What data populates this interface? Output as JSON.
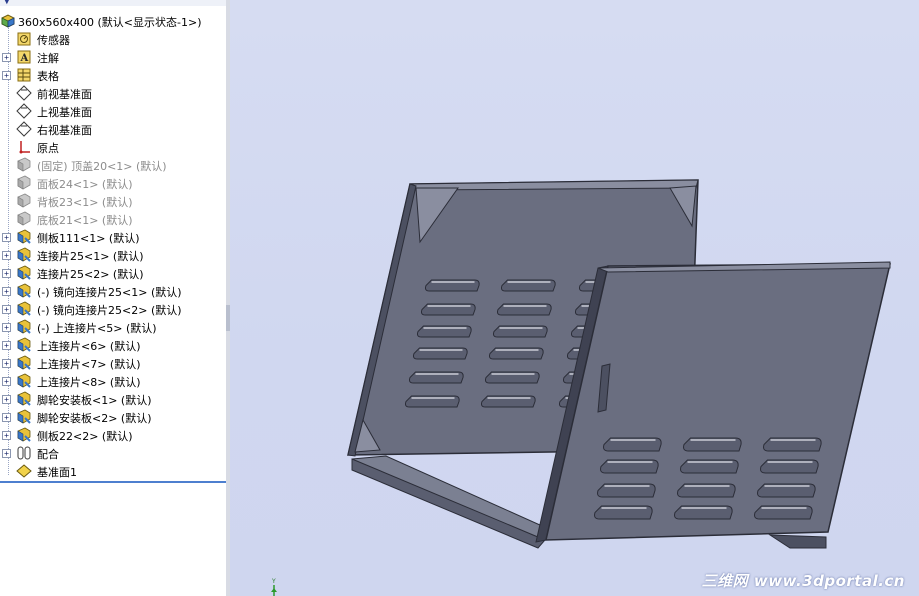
{
  "tree": {
    "root": {
      "label": "360x560x400   (默认<显示状态-1>)"
    },
    "items": [
      {
        "label": "传感器",
        "icon": "sensor-icon",
        "expander": "",
        "dim": false
      },
      {
        "label": "注解",
        "icon": "annotation-icon",
        "expander": "+",
        "dim": false
      },
      {
        "label": "表格",
        "icon": "table-icon",
        "expander": "+",
        "dim": false
      },
      {
        "label": "前视基准面",
        "icon": "plane-icon",
        "expander": "",
        "dim": false
      },
      {
        "label": "上视基准面",
        "icon": "plane-icon",
        "expander": "",
        "dim": false
      },
      {
        "label": "右视基准面",
        "icon": "plane-icon",
        "expander": "",
        "dim": false
      },
      {
        "label": "原点",
        "icon": "origin-icon",
        "expander": "",
        "dim": false
      },
      {
        "label": "(固定) 顶盖20<1> (默认)",
        "icon": "part-icon",
        "expander": "",
        "dim": true
      },
      {
        "label": "面板24<1> (默认)",
        "icon": "part-icon",
        "expander": "",
        "dim": true
      },
      {
        "label": "背板23<1> (默认)",
        "icon": "part-icon",
        "expander": "",
        "dim": true
      },
      {
        "label": "底板21<1> (默认)",
        "icon": "part-icon",
        "expander": "",
        "dim": true
      },
      {
        "label": "侧板111<1> (默认)",
        "icon": "part-icon",
        "expander": "+",
        "dim": false
      },
      {
        "label": "连接片25<1> (默认)",
        "icon": "part-icon",
        "expander": "+",
        "dim": false
      },
      {
        "label": "连接片25<2> (默认)",
        "icon": "part-icon",
        "expander": "+",
        "dim": false
      },
      {
        "label": "(-) 镜向连接片25<1> (默认)",
        "icon": "part-icon",
        "expander": "+",
        "dim": false
      },
      {
        "label": "(-) 镜向连接片25<2> (默认)",
        "icon": "part-icon",
        "expander": "+",
        "dim": false
      },
      {
        "label": "(-) 上连接片<5> (默认)",
        "icon": "part-icon",
        "expander": "+",
        "dim": false
      },
      {
        "label": "上连接片<6> (默认)",
        "icon": "part-icon",
        "expander": "+",
        "dim": false
      },
      {
        "label": "上连接片<7> (默认)",
        "icon": "part-icon",
        "expander": "+",
        "dim": false
      },
      {
        "label": "上连接片<8> (默认)",
        "icon": "part-icon",
        "expander": "+",
        "dim": false
      },
      {
        "label": "脚轮安装板<1> (默认)",
        "icon": "part-icon",
        "expander": "+",
        "dim": false
      },
      {
        "label": "脚轮安装板<2> (默认)",
        "icon": "part-icon",
        "expander": "+",
        "dim": false
      },
      {
        "label": "侧板22<2> (默认)",
        "icon": "part-icon",
        "expander": "+",
        "dim": false
      },
      {
        "label": "配合",
        "icon": "mates-icon",
        "expander": "+",
        "dim": false
      },
      {
        "label": "基准面1",
        "icon": "plane-yellow-icon",
        "expander": "",
        "dim": false
      }
    ]
  },
  "viewport": {
    "watermark": "三维网 www.3dportal.cn",
    "triad_label": "Y",
    "colors": {
      "panel": "#6a6e80",
      "panel_dark": "#4c5061",
      "edge": "#2b2d38",
      "background": "#d1d8f0"
    }
  }
}
